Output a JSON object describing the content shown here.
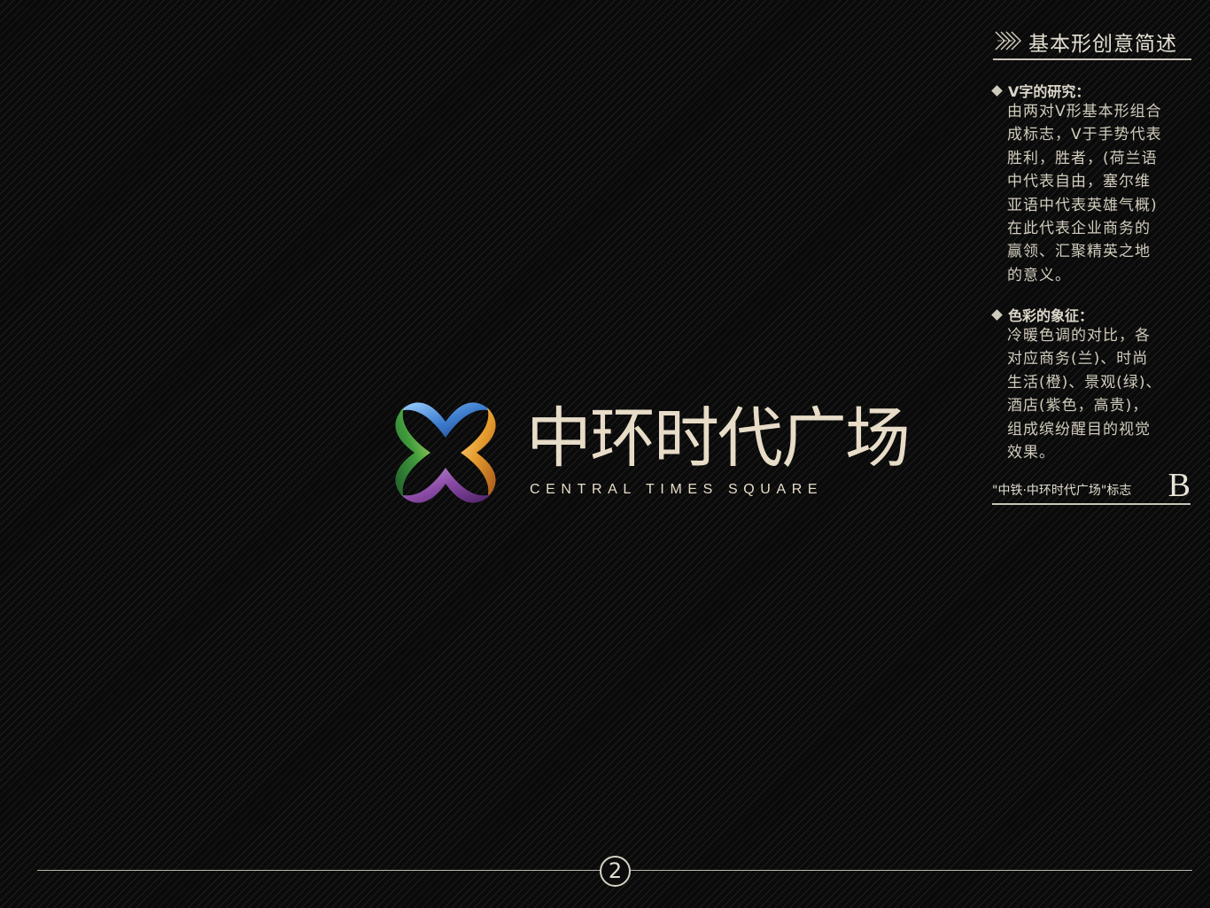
{
  "header": {
    "title": "基本形创意简述",
    "icon": "chevron-arrows-icon"
  },
  "section_v": {
    "heading": "V字的研究：",
    "lines": [
      "由两对V形基本形组合",
      "成标志，V于手势代表",
      "胜利，胜者，(荷兰语",
      "中代表自由，塞尔维",
      "亚语中代表英雄气概)",
      "在此代表企业商务的",
      "赢领、汇聚精英之地",
      "的意义。"
    ]
  },
  "section_color": {
    "heading": "色彩的象征：",
    "lines": [
      "冷暖色调的对比，各",
      "对应商务(兰)、时尚",
      "生活(橙)、景观(绿)、",
      "酒店(紫色，高贵)，",
      "组成缤纷醒目的视觉",
      "效果。"
    ]
  },
  "caption": {
    "text": "\"中铁·中环时代广场\"标志",
    "letter": "B"
  },
  "logo": {
    "name_cn": "中环时代广场",
    "name_en": "CENTRAL TIMES SQUARE",
    "colors": {
      "blue": "#3f7fd0",
      "orange": "#e59a2c",
      "green": "#3f9a3c",
      "purple": "#8a4aa6"
    }
  },
  "footer": {
    "page_number": "2"
  }
}
